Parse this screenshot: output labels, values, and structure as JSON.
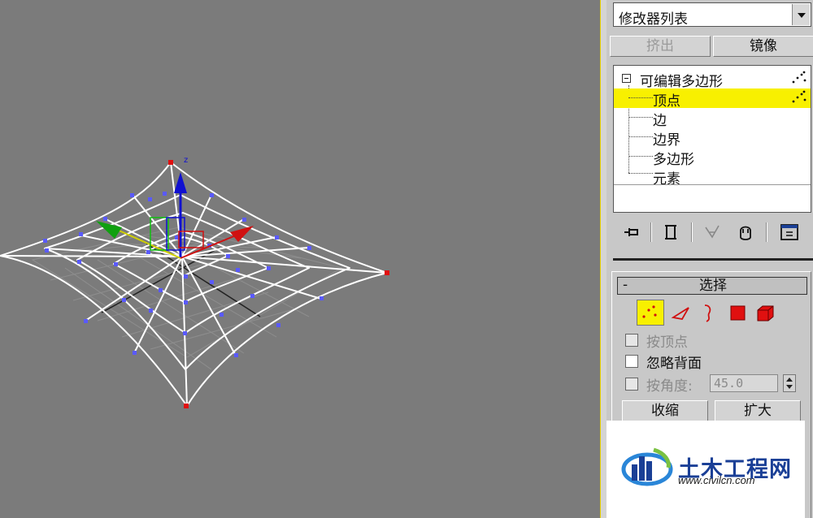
{
  "viewport": {
    "gizmo_axis_label": "z",
    "colors": {
      "background": "#7b7b7b",
      "mesh": "#ffffff",
      "vertex": "#5a5aff",
      "corner_vertex": "#e01010",
      "x_axis": "#d01010",
      "y_axis": "#10a010",
      "z_axis": "#1010d0"
    }
  },
  "panel": {
    "modifier_list": "修改器列表",
    "buttons": {
      "extrude": "挤出",
      "mirror": "镜像"
    },
    "stack": {
      "root": "可编辑多边形",
      "items": [
        {
          "label": "顶点",
          "selected": true
        },
        {
          "label": "边",
          "selected": false
        },
        {
          "label": "边界",
          "selected": false
        },
        {
          "label": "多边形",
          "selected": false
        },
        {
          "label": "元素",
          "selected": false
        }
      ]
    },
    "stack_icons": [
      "pin-stack-icon",
      "show-end-result-icon",
      "make-unique-icon",
      "remove-modifier-icon",
      "configure-modifier-sets-icon"
    ],
    "selection": {
      "collapse_sign": "-",
      "title": "选择",
      "subobject_icons": [
        "vertex-icon",
        "edge-icon",
        "border-icon",
        "polygon-icon",
        "element-icon"
      ],
      "by_vertex": "按顶点",
      "ignore_backfacing": "忽略背面",
      "by_angle": "按角度:",
      "angle_value": "45.0",
      "shrink": "收缩",
      "grow": "扩大"
    }
  },
  "watermark": {
    "name": "土木工程网",
    "url": "www.civilcn.com"
  }
}
